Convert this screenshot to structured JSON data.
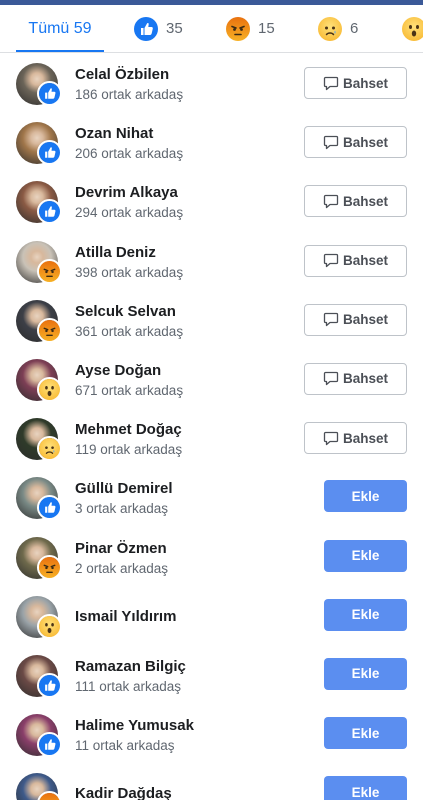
{
  "colors": {
    "accent": "#1877f2",
    "add_button": "#5b8ef0",
    "top_bar": "#3b5998"
  },
  "tabs": {
    "all_label": "Tümü 59",
    "like": {
      "icon": "like-icon",
      "count": "35"
    },
    "angry": {
      "icon": "angry-icon",
      "count": "15"
    },
    "sad": {
      "icon": "sad-icon",
      "count": "6"
    },
    "wow": {
      "icon": "wow-icon"
    }
  },
  "people": [
    {
      "name": "Celal Özbilen",
      "mutual": "186 ortak arkadaş",
      "reaction": "like",
      "action": "Bahset",
      "avatar": "#6b6458"
    },
    {
      "name": "Ozan Nihat",
      "mutual": "206 ortak arkadaş",
      "reaction": "like",
      "action": "Bahset",
      "avatar": "#a0764a"
    },
    {
      "name": "Devrim Alkaya",
      "mutual": "294 ortak arkadaş",
      "reaction": "like",
      "action": "Bahset",
      "avatar": "#8a5a44"
    },
    {
      "name": "Atilla Deniz",
      "mutual": "398 ortak arkadaş",
      "reaction": "angry",
      "action": "Bahset",
      "avatar": "#c9c2b7"
    },
    {
      "name": "Selcuk Selvan",
      "mutual": "361 ortak arkadaş",
      "reaction": "angry",
      "action": "Bahset",
      "avatar": "#3c3f47"
    },
    {
      "name": "Ayse Doğan",
      "mutual": "671 ortak arkadaş",
      "reaction": "wow",
      "action": "Bahset",
      "avatar": "#7d3f55"
    },
    {
      "name": "Mehmet Doğaç",
      "mutual": "119 ortak arkadaş",
      "reaction": "sad",
      "action": "Bahset",
      "avatar": "#2f3b2a"
    },
    {
      "name": "Güllü Demirel",
      "mutual": "3 ortak arkadaş",
      "reaction": "like",
      "action": "Ekle",
      "avatar": "#7a8a86"
    },
    {
      "name": "Pinar Özmen",
      "mutual": "2 ortak arkadaş",
      "reaction": "angry",
      "action": "Ekle",
      "avatar": "#6f6a4c"
    },
    {
      "name": "Ismail Yıldırım",
      "mutual": "",
      "reaction": "wow",
      "action": "Ekle",
      "avatar": "#9aa3a8"
    },
    {
      "name": "Ramazan Bilgiç",
      "mutual": "111 ortak arkadaş",
      "reaction": "like",
      "action": "Ekle",
      "avatar": "#6b4a46"
    },
    {
      "name": "Halime Yumusak",
      "mutual": "11 ortak arkadaş",
      "reaction": "like",
      "action": "Ekle",
      "avatar": "#8a3f6a"
    },
    {
      "name": "Kadir Dağdaş",
      "mutual": "",
      "reaction": "angry",
      "action": "Ekle",
      "avatar": "#3e5a8a"
    }
  ]
}
